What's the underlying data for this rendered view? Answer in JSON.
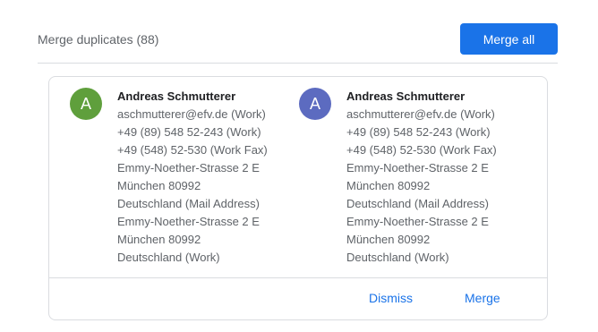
{
  "header": {
    "title": "Merge duplicates (88)",
    "merge_all_label": "Merge all"
  },
  "colors": {
    "accent": "#1a73e8",
    "avatar_1": "#5f9f3c",
    "avatar_2": "#5c6bc0"
  },
  "contacts": [
    {
      "initial": "A",
      "name": "Andreas Schmutterer",
      "lines": [
        "aschmutterer@efv.de (Work)",
        "+49 (89) 548 52-243 (Work)",
        "+49 (548) 52-530 (Work Fax)",
        "Emmy-Noether-Strasse 2 E",
        "München 80992",
        "Deutschland (Mail Address)",
        "Emmy-Noether-Strasse 2 E",
        "München 80992",
        "Deutschland (Work)"
      ]
    },
    {
      "initial": "A",
      "name": "Andreas Schmutterer",
      "lines": [
        "aschmutterer@efv.de (Work)",
        "+49 (89) 548 52-243 (Work)",
        "+49 (548) 52-530 (Work Fax)",
        "Emmy-Noether-Strasse 2 E",
        "München 80992",
        "Deutschland (Mail Address)",
        "Emmy-Noether-Strasse 2 E",
        "München 80992",
        "Deutschland (Work)"
      ]
    }
  ],
  "actions": {
    "dismiss_label": "Dismiss",
    "merge_label": "Merge"
  }
}
